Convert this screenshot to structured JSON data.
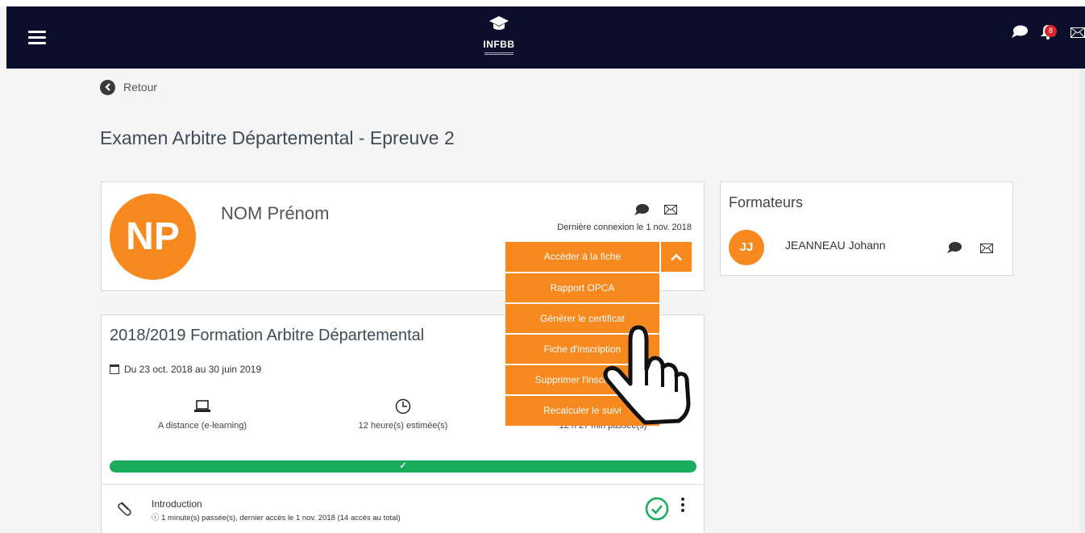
{
  "navbar": {
    "logo_text": "INFBB",
    "notification_count": "8"
  },
  "back": {
    "label": "Retour"
  },
  "page": {
    "title": "Examen Arbitre Départemental - Epreuve 2"
  },
  "user": {
    "initials": "NP",
    "name": "NOM Prénom",
    "last_login": "Dernière connexion le 1 nov. 2018"
  },
  "menu": {
    "items": [
      "Accéder à la fiche",
      "Rapport OPCA",
      "Générer le certificat",
      "Fiche d'inscription",
      "Supprimer l'inscription",
      "Recalculer le suivi"
    ]
  },
  "trainers": {
    "title": "Formateurs",
    "items": [
      {
        "initials": "JJ",
        "name": "JEANNEAU Johann"
      }
    ]
  },
  "course": {
    "title": "2018/2019 Formation Arbitre Départemental",
    "dates": "Du 23 oct. 2018 au 30 juin 2019",
    "stats": [
      {
        "icon": "laptop-icon",
        "label": "A distance (e-learning)"
      },
      {
        "icon": "clock-icon",
        "label": "12 heure(s) estimée(s)"
      },
      {
        "icon": "hourglass-icon",
        "label": "12 h 27 min passée(s)"
      }
    ],
    "progress_check": "✓",
    "progress_fraction": 1.0
  },
  "lesson": {
    "title": "Introduction",
    "meta": "ⓘ 1 minute(s) passée(s), dernier accès le 1 nov. 2018 (14 accès au total)"
  },
  "colors": {
    "navbar": "#0b0f2c",
    "accent": "#f7891f",
    "progress": "#1aab5c",
    "badge": "#d9252a"
  }
}
